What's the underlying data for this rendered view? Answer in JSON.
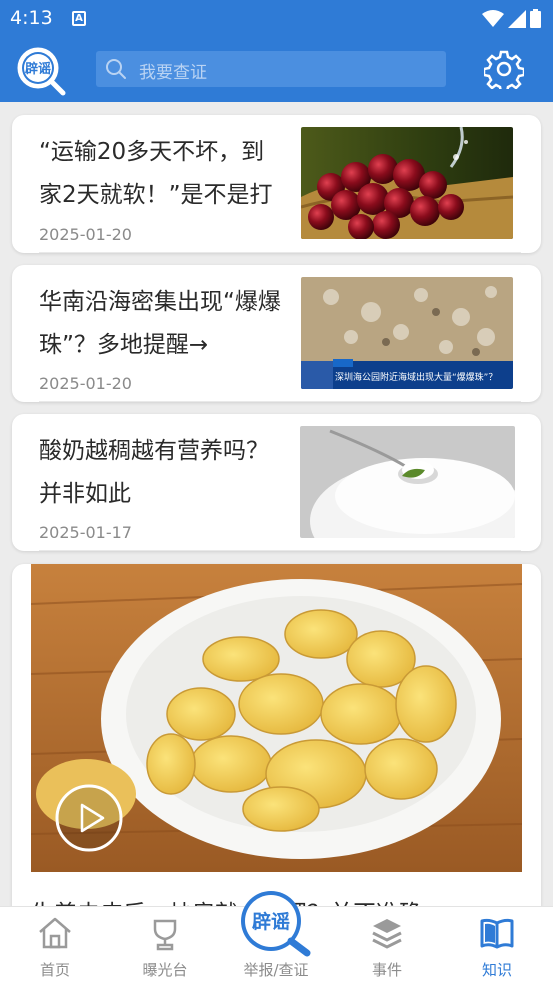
{
  "status_bar": {
    "time": "4:13",
    "notification_letter": "A"
  },
  "header": {
    "logo_text": "辟谣",
    "search_placeholder": "我要查证"
  },
  "feed": {
    "articles": [
      {
        "title": "“运输20多天不坏，到家2天就软！”是不是打",
        "date": "2025-01-20",
        "thumb_icon": "cherries-photo"
      },
      {
        "title": "华南沿海密集出现“爆爆珠”？多地提醒→",
        "date": "2025-01-20",
        "thumb_icon": "beach-news-photo",
        "thumb_caption": "深圳海公园附近海域出现大量“爆爆珠”？"
      },
      {
        "title": "酸奶越稠越有营养吗？并非如此",
        "date": "2025-01-17",
        "thumb_icon": "yogurt-photo"
      }
    ],
    "video": {
      "title": "生姜去皮后，炒房就会减肥？并不准确",
      "thumb_icon": "ginger-slices-photo"
    }
  },
  "bottom_nav": {
    "items": [
      {
        "label": "首页",
        "icon": "home-icon"
      },
      {
        "label": "曝光台",
        "icon": "trophy-icon"
      },
      {
        "label": "举报/查证",
        "icon": "report-logo-icon",
        "logo_text": "辟谣"
      },
      {
        "label": "事件",
        "icon": "layers-icon"
      },
      {
        "label": "知识",
        "icon": "book-icon",
        "active": true
      }
    ]
  },
  "colors": {
    "primary": "#2f7bd6",
    "background": "#ececec",
    "inactive": "#8c8c8c"
  }
}
